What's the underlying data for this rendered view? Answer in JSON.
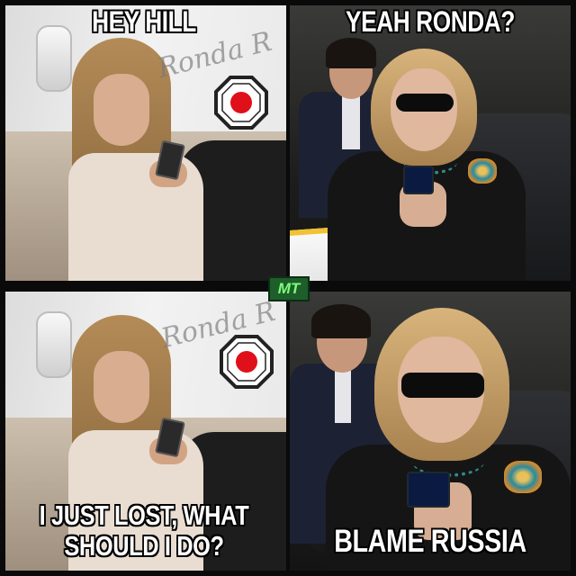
{
  "panels": [
    {
      "caption": "HEY HILL",
      "watermark": "Ronda R"
    },
    {
      "caption": "YEAH RONDA?"
    },
    {
      "caption_lines": [
        "I JUST LOST, WHAT",
        "SHOULD I DO?"
      ],
      "watermark": "Ronda R"
    },
    {
      "caption": "BLAME RUSSIA"
    }
  ],
  "badge": "MT",
  "colors": {
    "badge_bg": "#1d5e2b",
    "badge_text": "#7dff7a",
    "logo_dot": "#e0101a",
    "caption_text": "#ffffff"
  },
  "icons": [
    "ronda-octagon-logo-icon",
    "ronda-octagon-logo-icon"
  ]
}
